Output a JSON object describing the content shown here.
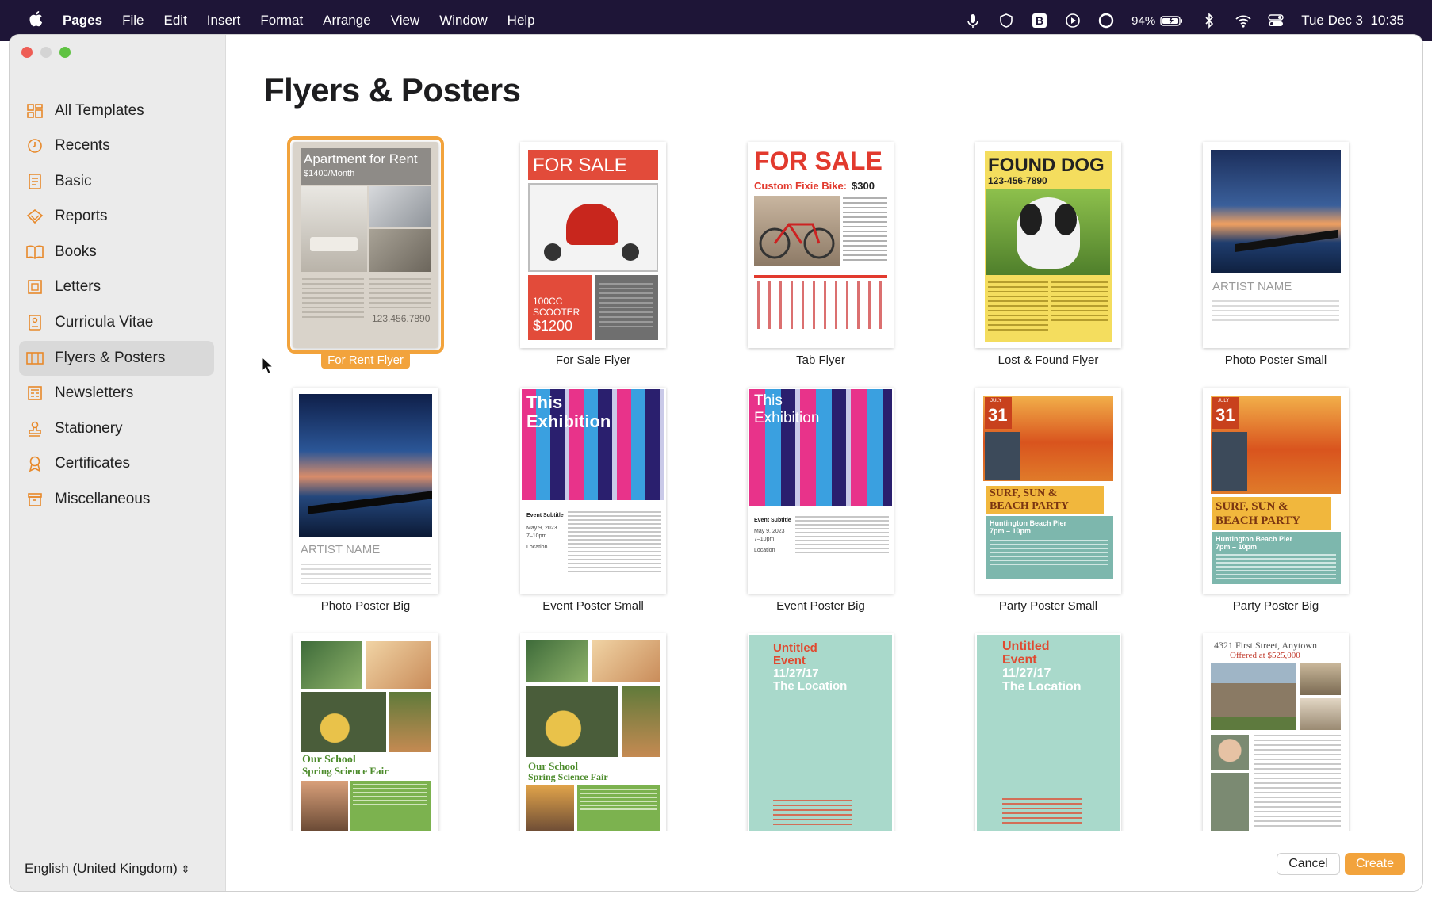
{
  "menubar": {
    "app": "Pages",
    "items": [
      "File",
      "Edit",
      "Insert",
      "Format",
      "Arrange",
      "View",
      "Window",
      "Help"
    ],
    "battery": "94%",
    "datetime": "Tue Dec 3  10:35"
  },
  "sidebar": {
    "items": [
      {
        "label": "All Templates",
        "icon": "grid-icon"
      },
      {
        "label": "Recents",
        "icon": "clock-icon"
      },
      {
        "label": "Basic",
        "icon": "document-icon"
      },
      {
        "label": "Reports",
        "icon": "report-icon"
      },
      {
        "label": "Books",
        "icon": "book-icon"
      },
      {
        "label": "Letters",
        "icon": "letter-icon"
      },
      {
        "label": "Curricula Vitae",
        "icon": "cv-icon"
      },
      {
        "label": "Flyers & Posters",
        "icon": "flyer-icon"
      },
      {
        "label": "Newsletters",
        "icon": "newsletter-icon"
      },
      {
        "label": "Stationery",
        "icon": "stamp-icon"
      },
      {
        "label": "Certificates",
        "icon": "ribbon-icon"
      },
      {
        "label": "Miscellaneous",
        "icon": "box-icon"
      }
    ],
    "selected": "Flyers & Posters",
    "language": "English (United Kingdom)"
  },
  "main": {
    "title": "Flyers & Posters",
    "templates": [
      {
        "name": "For Rent Flyer",
        "text": [
          "Apartment for Rent",
          "$1400/Month",
          "123.456.7890"
        ]
      },
      {
        "name": "For Sale Flyer",
        "text": [
          "FOR SALE",
          "100CC",
          "SCOOTER",
          "$1200"
        ]
      },
      {
        "name": "Tab Flyer",
        "text": [
          "FOR SALE",
          "Custom Fixie Bike:",
          "$300"
        ]
      },
      {
        "name": "Lost & Found Flyer",
        "text": [
          "FOUND DOG",
          "123-456-7890"
        ]
      },
      {
        "name": "Photo Poster Small",
        "text": [
          "ARTIST NAME"
        ]
      },
      {
        "name": "Photo Poster Big",
        "text": [
          "ARTIST NAME"
        ]
      },
      {
        "name": "Event Poster Small",
        "text": [
          "This",
          "Exhibition",
          "Event Subtitle",
          "May 9, 2023",
          "7–10pm",
          "Location"
        ]
      },
      {
        "name": "Event Poster Big",
        "text": [
          "This",
          "Exhibition",
          "Event Subtitle",
          "May 9, 2023",
          "7–10pm",
          "Location"
        ]
      },
      {
        "name": "Party Poster Small",
        "text": [
          "JULY",
          "31",
          "SURF, SUN &",
          "BEACH PARTY",
          "Huntington Beach Pier",
          "7pm – 10pm"
        ]
      },
      {
        "name": "Party Poster Big",
        "text": [
          "JULY",
          "31",
          "SURF, SUN &",
          "BEACH PARTY",
          "Huntington Beach Pier",
          "7pm – 10pm"
        ]
      },
      {
        "name": "",
        "text": [
          "Our School",
          "Spring Science Fair"
        ]
      },
      {
        "name": "",
        "text": [
          "Our School",
          "Spring Science Fair"
        ]
      },
      {
        "name": "",
        "text": [
          "Untitled",
          "Event",
          "11/27/17",
          "The Location"
        ]
      },
      {
        "name": "",
        "text": [
          "Untitled",
          "Event",
          "11/27/17",
          "The Location"
        ]
      },
      {
        "name": "",
        "text": [
          "4321 First Street, Anytown",
          "Offered at $525,000"
        ]
      }
    ],
    "selected": "For Rent Flyer"
  },
  "footer": {
    "cancel": "Cancel",
    "create": "Create"
  },
  "colors": {
    "accent": "#f2a33c",
    "menubar": "#1e1537",
    "sidebar": "#ebebeb"
  }
}
